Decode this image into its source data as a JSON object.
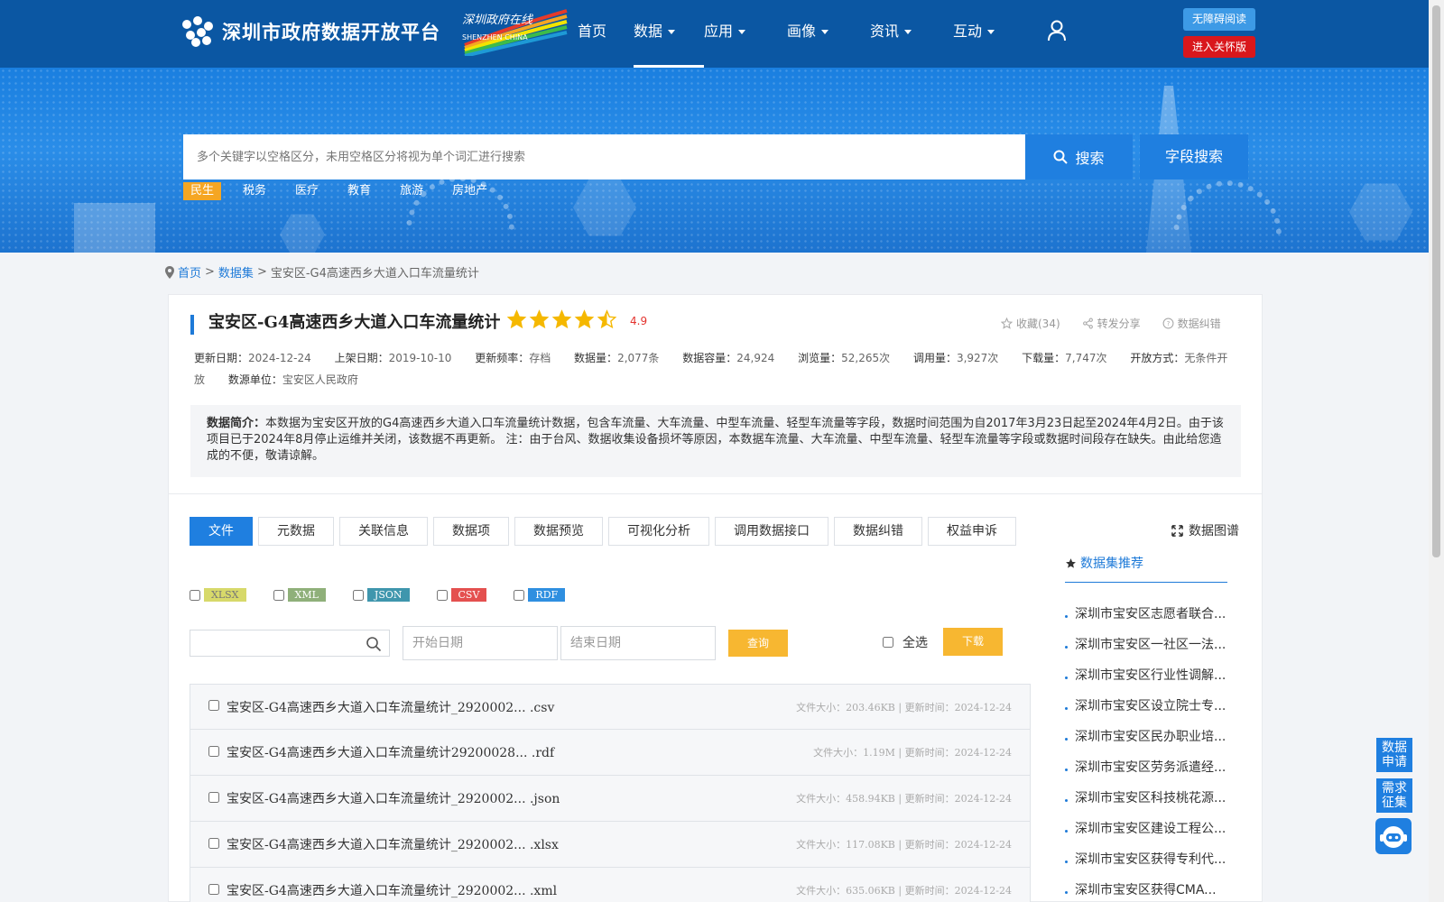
{
  "header": {
    "site_name": "深圳市政府数据开放平台",
    "sub_logo_title": "深圳政府在线",
    "sub_logo_caption": "SHENZHEN CHINA",
    "nav": [
      {
        "label": "首页",
        "dropdown": false,
        "active": false
      },
      {
        "label": "数据",
        "dropdown": true,
        "active": true
      },
      {
        "label": "应用",
        "dropdown": true,
        "active": false
      },
      {
        "label": "画像",
        "dropdown": true,
        "active": false
      },
      {
        "label": "资讯",
        "dropdown": true,
        "active": false
      },
      {
        "label": "互动",
        "dropdown": true,
        "active": false
      }
    ],
    "accessibility_button": "无障碍阅读",
    "care_mode_button": "进入关怀版",
    "user_icon": "user-icon"
  },
  "search": {
    "placeholder": "多个关键字以空格区分，未用空格区分将视为单个词汇进行搜索",
    "search_button": "搜索",
    "field_search_button": "字段搜索",
    "tags": [
      "民生",
      "税务",
      "医疗",
      "教育",
      "旅游",
      "房地产"
    ],
    "active_tag": "民生"
  },
  "breadcrumb": {
    "home": "首页",
    "sep": ">",
    "dataset": "数据集",
    "current": "宝安区-G4高速西乡大道入口车流量统计"
  },
  "dataset": {
    "title": "宝安区-G4高速西乡大道入口车流量统计",
    "rating_value": 4.5,
    "rating_text": "4.9",
    "collect": "收藏(34)",
    "share": "转发分享",
    "correct": "数据纠错",
    "meta": [
      {
        "k": "更新日期：",
        "v": "2024-12-24"
      },
      {
        "k": "上架日期：",
        "v": "2019-10-10"
      },
      {
        "k": "更新频率：",
        "v": "存档"
      },
      {
        "k": "数据量：",
        "v": "2,077条"
      },
      {
        "k": "数据容量：",
        "v": "24,924"
      },
      {
        "k": "浏览量：",
        "v": "52,265次"
      },
      {
        "k": "调用量：",
        "v": "3,927次"
      },
      {
        "k": "下载量：",
        "v": "7,747次"
      },
      {
        "k": "开放方式：",
        "v": "无条件开放"
      },
      {
        "k": "数源单位：",
        "v": "宝安区人民政府"
      }
    ],
    "intro_label": "数据简介：",
    "intro_text": "本数据为宝安区开放的G4高速西乡大道入口车流量统计数据，包含车流量、大车流量、中型车流量、轻型车流量等字段，数据时间范围为自2017年3月23日起至2024年4月2日。由于该项目已于2024年8月停止运维并关闭，该数据不再更新。 注：由于台风、数据收集设备损坏等原因，本数据车流量、大车流量、中型车流量、轻型车流量等字段或数据时间段存在缺失。由此给您造成的不便，敬请谅解。"
  },
  "tabs": [
    "文件",
    "元数据",
    "关联信息",
    "数据项",
    "数据预览",
    "可视化分析",
    "调用数据接口",
    "数据纠错",
    "权益申诉"
  ],
  "graph_link": "数据图谱",
  "formats": [
    {
      "label": "XLSX",
      "color": "#d7d96a"
    },
    {
      "label": "XML",
      "color": "#8fb07a"
    },
    {
      "label": "JSON",
      "color": "#3f96ad"
    },
    {
      "label": "CSV",
      "color": "#e4504f"
    },
    {
      "label": "RDF",
      "color": "#2f8fe0"
    }
  ],
  "filters": {
    "keyword_value": "",
    "start_date": "开始日期",
    "end_date": "结束日期",
    "query_button": "查询",
    "select_all": "全选",
    "download_button": "下载"
  },
  "files": [
    {
      "name": "宝安区-G4高速西乡大道入口车流量统计_2920002... .csv",
      "size": "文件大小：203.46KB",
      "updated": "更新时间：2024-12-24"
    },
    {
      "name": "宝安区-G4高速西乡大道入口车流量统计29200028... .rdf",
      "size": "文件大小：1.19M",
      "updated": "更新时间：2024-12-24"
    },
    {
      "name": "宝安区-G4高速西乡大道入口车流量统计_2920002... .json",
      "size": "文件大小：458.94KB",
      "updated": "更新时间：2024-12-24"
    },
    {
      "name": "宝安区-G4高速西乡大道入口车流量统计_2920002... .xlsx",
      "size": "文件大小：117.08KB",
      "updated": "更新时间：2024-12-24"
    },
    {
      "name": "宝安区-G4高速西乡大道入口车流量统计_2920002... .xml",
      "size": "文件大小：635.06KB",
      "updated": "更新时间：2024-12-24"
    }
  ],
  "recommend": {
    "title": "数据集推荐",
    "items": [
      "深圳市宝安区志愿者联合...",
      "深圳市宝安区一社区一法...",
      "深圳市宝安区行业性调解...",
      "深圳市宝安区设立院士专...",
      "深圳市宝安区民办职业培...",
      "深圳市宝安区劳务派遣经...",
      "深圳市宝安区科技桃花源...",
      "深圳市宝安区建设工程公...",
      "深圳市宝安区获得专利代...",
      "深圳市宝安区获得CMA..."
    ]
  },
  "floating": {
    "apply": "数据申请",
    "demand": "需求征集",
    "robot_icon": "robot-icon"
  },
  "colors": {
    "header_bg": "#0b57a3",
    "accent": "#1f7fe0",
    "tag_active": "#f5a623",
    "care_red": "#d9171c",
    "star": "#f5b800",
    "rating_red": "#e3332e",
    "orange_button": "#f7b731"
  }
}
